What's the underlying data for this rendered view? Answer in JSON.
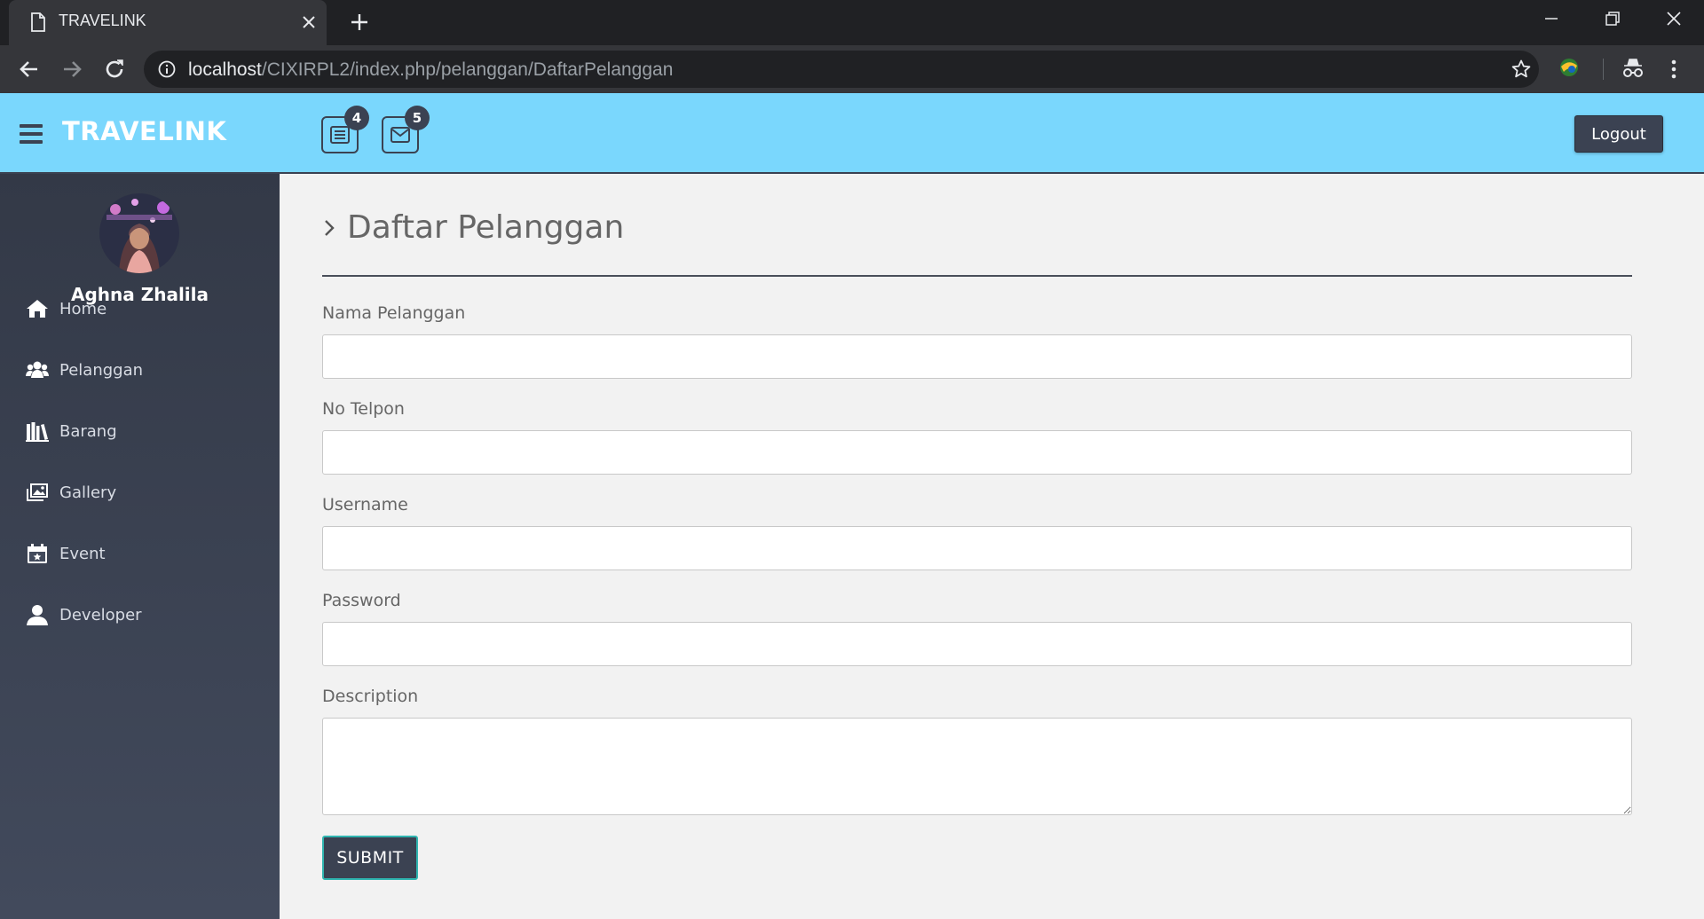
{
  "browser": {
    "tab_title": "TRAVELINK",
    "url_host": "localhost",
    "url_path": "/CIXIRPL2/index.php/pelanggan/DaftarPelanggan"
  },
  "header": {
    "brand": "TRAVELINK",
    "notifications_badge": "4",
    "messages_badge": "5",
    "logout_label": "Logout",
    "bg_color": "#7ad7fd",
    "accent_color": "#3b4252"
  },
  "sidebar": {
    "user_name": "Aghna Zhalila",
    "items": [
      {
        "label": "Home",
        "icon": "home-icon"
      },
      {
        "label": "Pelanggan",
        "icon": "users-icon"
      },
      {
        "label": "Barang",
        "icon": "books-icon"
      },
      {
        "label": "Gallery",
        "icon": "gallery-icon"
      },
      {
        "label": "Event",
        "icon": "calendar-icon"
      },
      {
        "label": "Developer",
        "icon": "user-icon"
      }
    ]
  },
  "main": {
    "page_title": "Daftar Pelanggan",
    "fields": [
      {
        "label": "Nama Pelanggan",
        "value": ""
      },
      {
        "label": "No Telpon",
        "value": ""
      },
      {
        "label": "Username",
        "value": ""
      },
      {
        "label": "Password",
        "value": ""
      },
      {
        "label": "Description",
        "value": ""
      }
    ],
    "submit_label": "SUBMIT"
  }
}
